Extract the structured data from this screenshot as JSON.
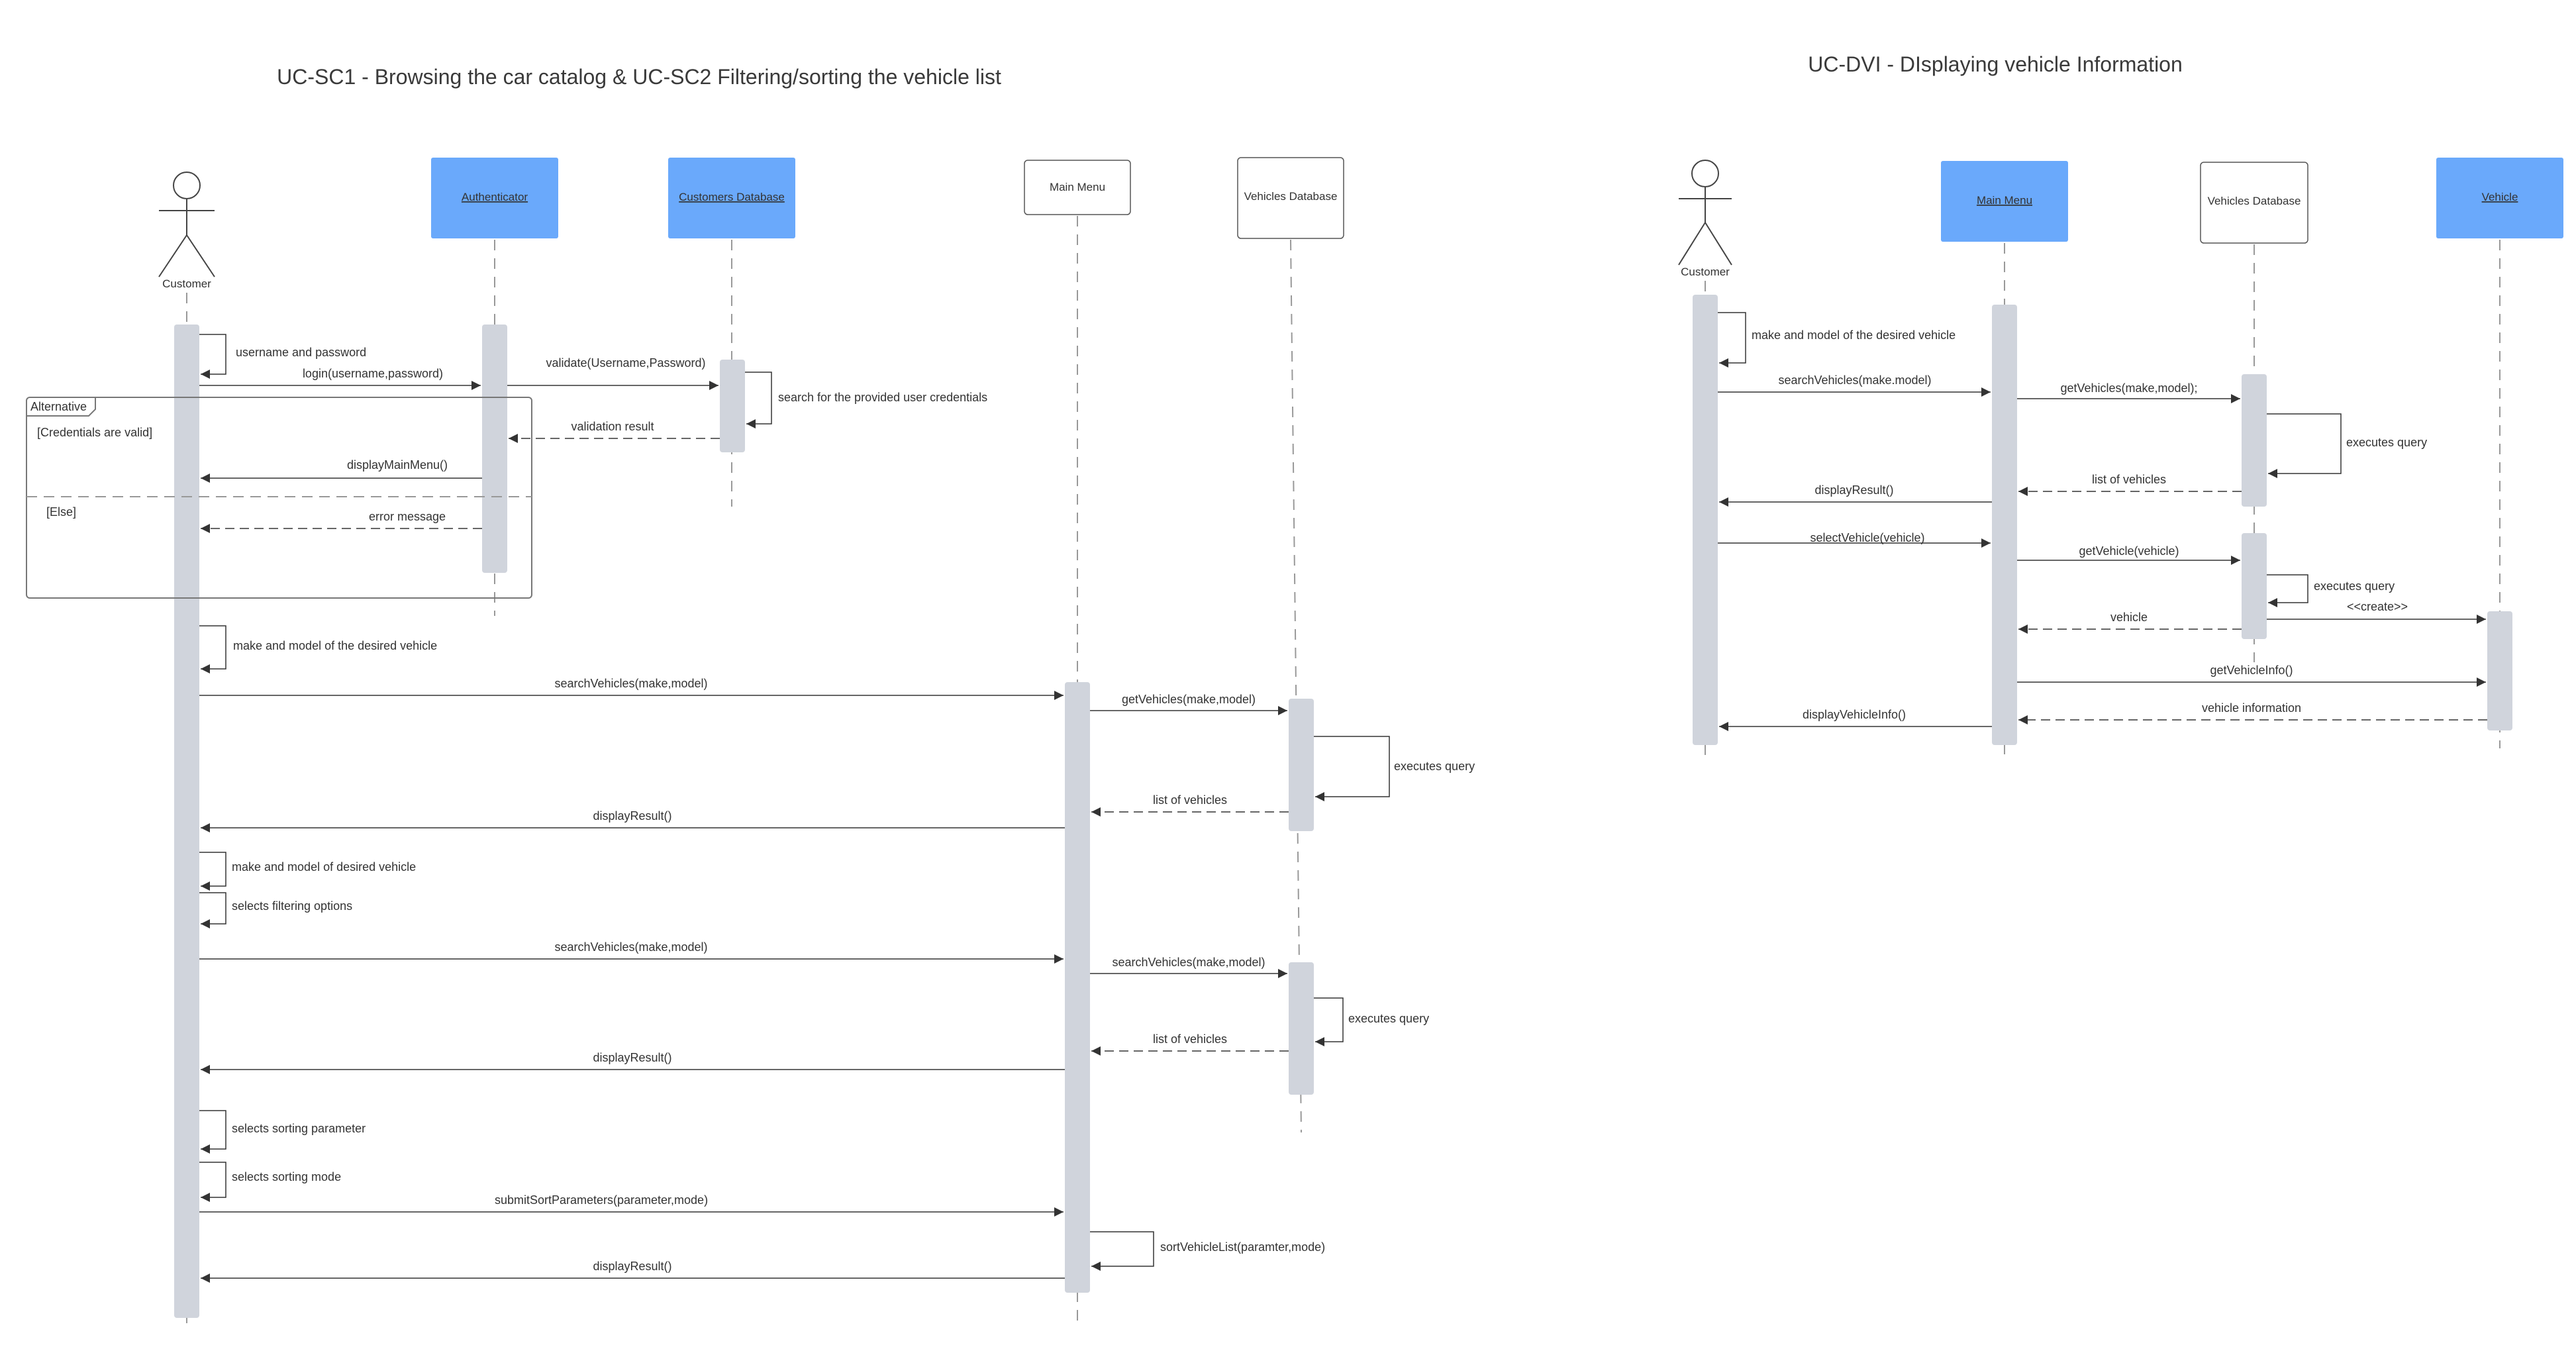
{
  "diagram1": {
    "title": "UC-SC1 - Browsing the car catalog & UC-SC2 Filtering/sorting the vehicle list",
    "participants": {
      "customer": "Customer",
      "authenticator": "Authenticator",
      "customers_db": "Customers Database",
      "main_menu": "Main Menu",
      "vehicles_db": "Vehicles Database"
    },
    "fragment": {
      "label": "Alternative",
      "guard1": "[Credentials are valid]",
      "guard2": "[Else]"
    },
    "messages": [
      "username and password",
      "login(username,password)",
      "validate(Username,Password)",
      "search for the provided user credentials",
      "validation result",
      "displayMainMenu()",
      "error message",
      "make and model of the desired vehicle",
      "searchVehicles(make,model)",
      "getVehicles(make,model)",
      "executes query",
      "list of vehicles",
      "displayResult()",
      "make and model of desired vehicle",
      "selects filtering options",
      "searchVehicles(make,model)",
      "searchVehicles(make,model)",
      "executes query",
      "list of vehicles",
      "displayResult()",
      "selects sorting parameter",
      "selects sorting mode",
      "submitSortParameters(parameter,mode)",
      "sortVehicleList(paramter,mode)",
      "displayResult()"
    ]
  },
  "diagram2": {
    "title": "UC-DVI - DIsplaying vehicle Information",
    "participants": {
      "customer": "Customer",
      "main_menu": "Main Menu",
      "vehicles_db": "Vehicles Database",
      "vehicle": "Vehicle"
    },
    "messages": [
      "make and model of the desired vehicle",
      "searchVehicles(make.model)",
      "getVehicles(make,model);",
      "executes query",
      "list of vehicles",
      "displayResult()",
      "selectVehicle(vehicle)",
      "getVehicle(vehicle)",
      "executes query",
      "vehicle",
      "<<create>>",
      "getVehicleInfo()",
      "vehicle information",
      "displayVehicleInfo()"
    ]
  },
  "colors": {
    "highlight_header": "#6aa9fb",
    "activation": "#d0d4dc",
    "line": "#444444",
    "lifeline": "#999999"
  }
}
